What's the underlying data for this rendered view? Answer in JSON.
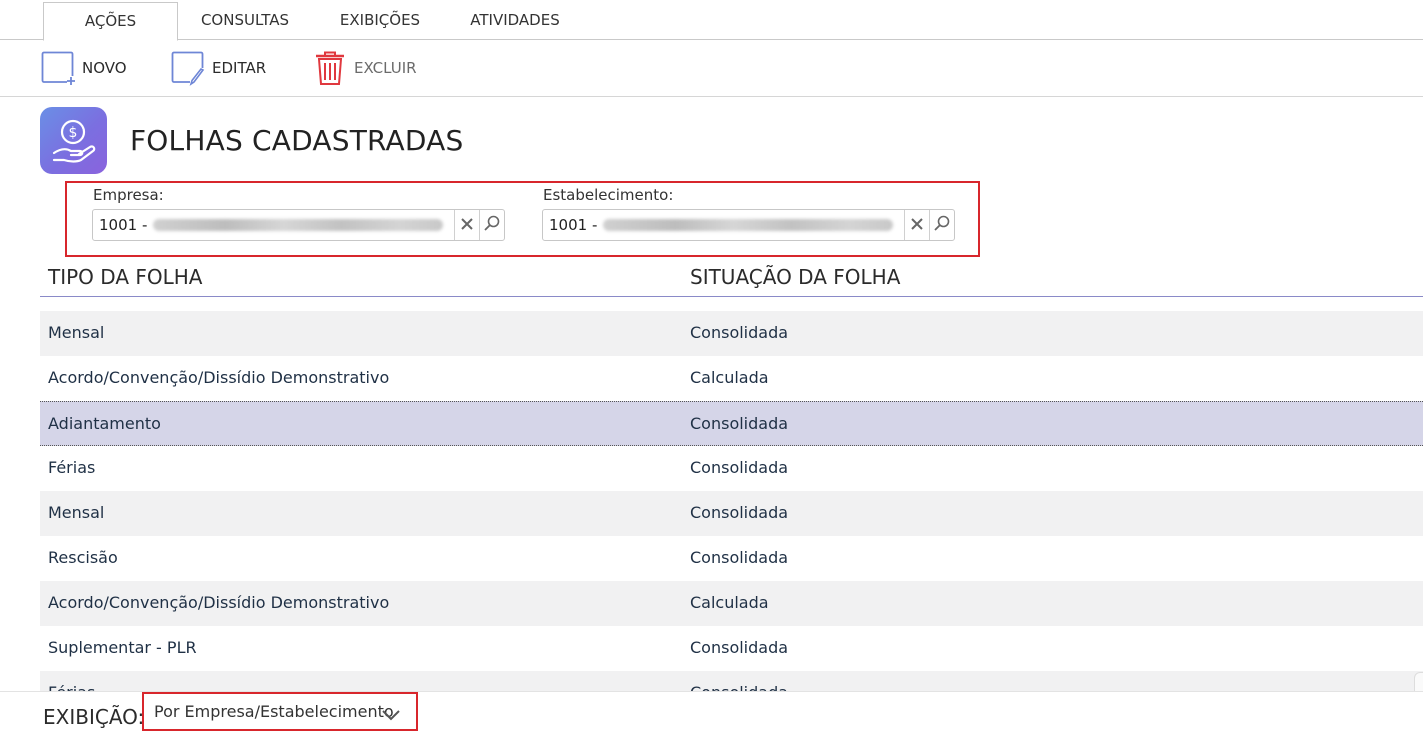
{
  "tabs": [
    {
      "label": "AÇÕES",
      "active": true
    },
    {
      "label": "CONSULTAS",
      "active": false
    },
    {
      "label": "EXIBIÇÕES",
      "active": false
    },
    {
      "label": "ATIVIDADES",
      "active": false
    }
  ],
  "toolbar": {
    "new_label": "NOVO",
    "edit_label": "EDITAR",
    "delete_label": "EXCLUIR",
    "delete_color": "#e0383e",
    "icon_color": "#6e86d6"
  },
  "page": {
    "title": "FOLHAS CADASTRADAS",
    "icon": "money-hand-icon",
    "accent": "#7b6fe0"
  },
  "filters": {
    "company_label": "Empresa:",
    "company_value": "1001 -",
    "establishment_label": "Estabelecimento:",
    "establishment_value": "1001 -",
    "highlight_color": "#d8262c"
  },
  "table": {
    "columns": [
      "TIPO DA FOLHA",
      "SITUAÇÃO DA FOLHA"
    ],
    "rows": [
      {
        "tipo": "Mensal",
        "situacao": "Consolidada"
      },
      {
        "tipo": "Acordo/Convenção/Dissídio Demonstrativo",
        "situacao": "Calculada"
      },
      {
        "tipo": "Adiantamento",
        "situacao": "Consolidada",
        "selected": true
      },
      {
        "tipo": "Férias",
        "situacao": "Consolidada"
      },
      {
        "tipo": "Mensal",
        "situacao": "Consolidada"
      },
      {
        "tipo": "Rescisão",
        "situacao": "Consolidada"
      },
      {
        "tipo": "Acordo/Convenção/Dissídio Demonstrativo",
        "situacao": "Calculada"
      },
      {
        "tipo": "Suplementar - PLR",
        "situacao": "Consolidada"
      },
      {
        "tipo": "Férias",
        "situacao": "Consolidada"
      }
    ],
    "selected_color": "#d5d5e8"
  },
  "footer": {
    "view_label": "EXIBIÇÃO:",
    "view_value": "Por Empresa/Estabelecimento"
  }
}
